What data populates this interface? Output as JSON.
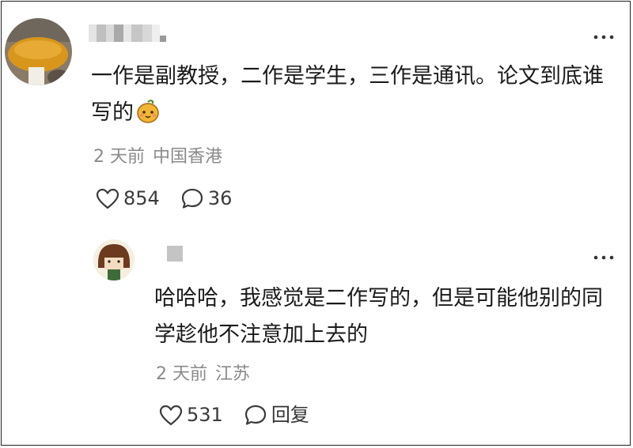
{
  "comments": [
    {
      "text": "一作是副教授，二作是学生，三作是通讯。论文到底谁写的",
      "emoji": "mango-face-emoji",
      "time": "2 天前",
      "location": "中国香港",
      "likes": "854",
      "replies": "36",
      "reply": {
        "text": "哈哈哈，我感觉是二作写的，但是可能他别的同学趁他不注意加上去的",
        "time": "2 天前",
        "location": "江苏",
        "likes": "531",
        "reply_label": "回复"
      }
    }
  ],
  "icons": {
    "more": "more-dots-icon",
    "like": "heart-icon",
    "comment": "comment-bubble-icon"
  },
  "colors": {
    "text": "#1a1a1a",
    "meta": "#8a8a8a",
    "icon": "#3a3a3a"
  }
}
